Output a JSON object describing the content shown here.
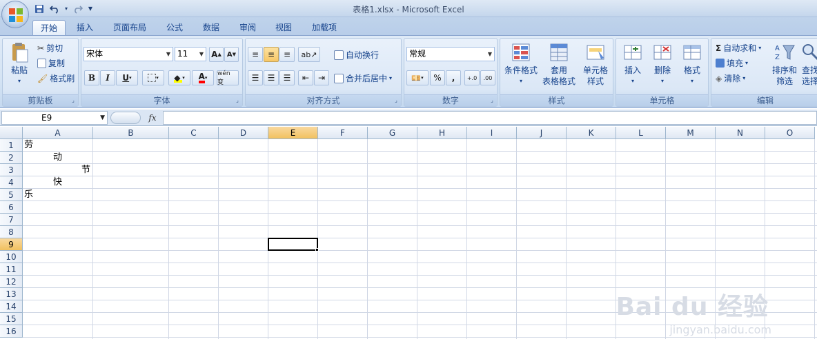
{
  "window": {
    "title": "表格1.xlsx - Microsoft Excel"
  },
  "quick_access": {
    "save": "save-icon",
    "undo": "undo-icon",
    "redo": "redo-icon",
    "customize": "▼"
  },
  "tabs": [
    {
      "label": "开始",
      "active": true
    },
    {
      "label": "插入"
    },
    {
      "label": "页面布局"
    },
    {
      "label": "公式"
    },
    {
      "label": "数据"
    },
    {
      "label": "审阅"
    },
    {
      "label": "视图"
    },
    {
      "label": "加载项"
    }
  ],
  "ribbon": {
    "clipboard": {
      "label": "剪贴板",
      "paste": "粘贴",
      "cut": "剪切",
      "copy": "复制",
      "format_painter": "格式刷"
    },
    "font": {
      "label": "字体",
      "font_name": "宋体",
      "font_size": "11",
      "bold": "B",
      "italic": "I",
      "underline": "U",
      "grow": "A",
      "shrink": "A",
      "phonetic": "wén 变"
    },
    "alignment": {
      "label": "对齐方式",
      "wrap_text": "自动换行",
      "merge_center": "合并后居中"
    },
    "number": {
      "label": "数字",
      "format": "常规",
      "percent": "%",
      "comma": ",",
      "increase_decimal": "←.0 .00",
      "decrease_decimal": ".00 →.0"
    },
    "styles": {
      "label": "样式",
      "conditional": "条件格式",
      "table_format_1": "套用",
      "table_format_2": "表格格式",
      "cell_styles_1": "单元格",
      "cell_styles_2": "样式"
    },
    "cells": {
      "label": "单元格",
      "insert": "插入",
      "delete": "删除",
      "format": "格式"
    },
    "editing": {
      "label": "编辑",
      "autosum": "自动求和",
      "fill": "填充",
      "clear": "清除",
      "sort_1": "排序和",
      "sort_2": "筛选",
      "find_1": "查找",
      "find_2": "选择"
    }
  },
  "formula_bar": {
    "name_box": "E9",
    "fx": "fx",
    "value": ""
  },
  "columns": [
    "A",
    "B",
    "C",
    "D",
    "E",
    "F",
    "G",
    "H",
    "I",
    "J",
    "K",
    "L",
    "M",
    "N",
    "O"
  ],
  "rows": [
    "1",
    "2",
    "3",
    "4",
    "5",
    "6",
    "7",
    "8",
    "9",
    "10",
    "11",
    "12",
    "13",
    "14",
    "15",
    "16"
  ],
  "cells": {
    "A1": "劳",
    "A2": "动",
    "A3": "节",
    "A4": "快",
    "A5": "乐"
  },
  "selection": {
    "cell": "E9",
    "column": "E",
    "row": "9"
  },
  "watermark": {
    "line1": "Bai du 经验",
    "line2": "jingyan.baidu.com"
  }
}
